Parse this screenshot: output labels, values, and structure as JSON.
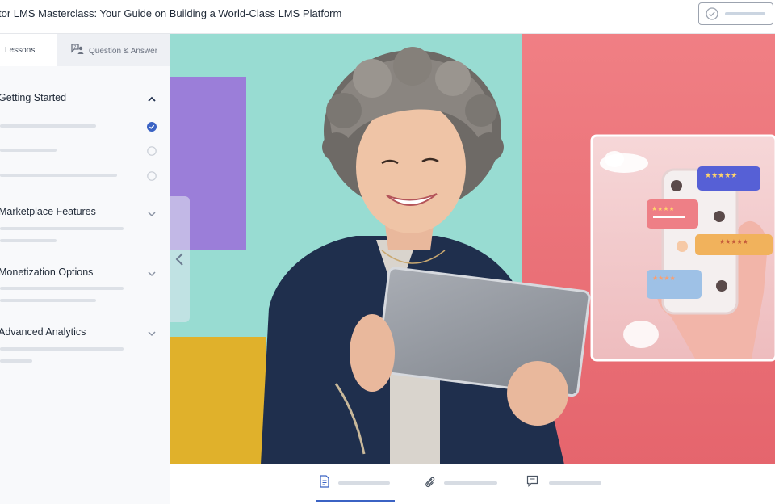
{
  "header": {
    "course_title": "tor LMS Masterclass: Your Guide on Building a World-Class LMS Platform",
    "complete_icon": "check-circle-icon"
  },
  "sidebar": {
    "tabs": [
      {
        "label": "Lessons",
        "active": true
      },
      {
        "label": "Question & Answer",
        "icon": "question-answer-icon",
        "active": false
      }
    ],
    "topics": [
      {
        "title": "Getting Started",
        "expanded": true,
        "lessons": [
          {
            "status": "completed",
            "status_icon": "check-circle-filled-icon"
          },
          {
            "status": "incomplete",
            "status_icon": "empty-circle-icon"
          },
          {
            "status": "incomplete",
            "status_icon": "empty-circle-icon"
          }
        ]
      },
      {
        "title": "Marketplace Features",
        "expanded": false
      },
      {
        "title": "Monetization Options",
        "expanded": false
      },
      {
        "title": "Advanced Analytics",
        "expanded": false
      }
    ],
    "collapse_icon": "chevron-left-icon"
  },
  "content": {
    "hero_image": "woman-using-tablet-with-reviews-illustration"
  },
  "bottom_tabs": [
    {
      "icon": "document-icon",
      "active": true
    },
    {
      "icon": "paperclip-icon",
      "active": false
    },
    {
      "icon": "comment-icon",
      "active": false
    }
  ],
  "colors": {
    "accent": "#3b63c4",
    "sidebar_bg": "#f8f9fb",
    "teal": "#98dcd2",
    "coral": "#ec7d82",
    "purple": "#9b7ed9",
    "mustard": "#e0b12b",
    "navy_shirt": "#1f2f4d"
  }
}
